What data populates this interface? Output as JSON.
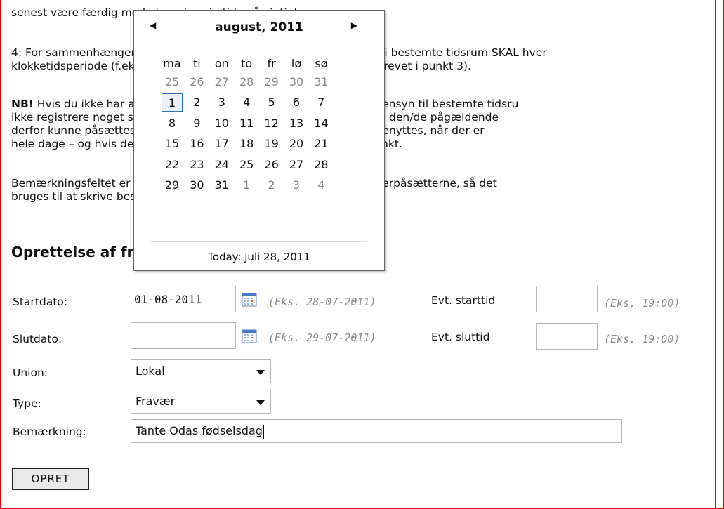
{
  "paragraphs": {
    "p0": "senest være færdig med at angive sin tid - så vigtigt.",
    "p1_line1": "4: For sammenhængende tidsrum hvor dommeren ikke kan dømme i bestemte tidsrum SKAL hver",
    "p1_line2": "klokketidsperiode (f.eks. 19:00-22:00) angives separatvis (som beskrevet i punkt 3).",
    "nb_label": "NB!",
    "p2_line1": " Hvis du ikke har angivet nogen begrænsede muligheder med hensyn til bestemte tidsru",
    "p2_line2": "ikke registrere noget som helst - da dommeren vil fremstå som ledig den/de pågældende",
    "p2_line3": "derfor kunne påsættes kampe. Felterne for tidsrum skal altså KUN benyttes, når der er",
    "p2_line4": "hele dage – og hvis det er tilfældet angives dets start- og sluttidspunkt.",
    "p3_line1": "Bemærkningsfeltet er til egne notater, og det kan ses ikke af dommerpåsætterne, så det",
    "p3_line2": "bruges til at skrive beskeder til dommerpåsætterne."
  },
  "heading": "Oprettelse af fravær",
  "form": {
    "start_label": "Startdato:",
    "start_value": "01-08-2011",
    "start_hint": "(Eks. 28-07-2011)",
    "start_time_label": "Evt. starttid",
    "start_time_value": "",
    "start_time_hint": "(Eks. 19:00)",
    "end_label": "Slutdato:",
    "end_value": "",
    "end_hint": "(Eks. 29-07-2011)",
    "end_time_label": "Evt. sluttid",
    "end_time_value": "",
    "end_time_hint": "(Eks. 19:00)",
    "union_label": "Union:",
    "union_value": "Lokal",
    "type_label": "Type:",
    "type_value": "Fravær",
    "remark_label": "Bemærkning:",
    "remark_value": "Tante Odas fødselsdag",
    "submit_label": "OPRET",
    "calendar_icon": "calendar-icon"
  },
  "calendar": {
    "title": "august, 2011",
    "prev": "◀",
    "next": "▶",
    "weekdays": [
      "ma",
      "ti",
      "on",
      "to",
      "fr",
      "lø",
      "sø"
    ],
    "weeks": [
      [
        "25",
        "26",
        "27",
        "28",
        "29",
        "30",
        "31"
      ],
      [
        "1",
        "2",
        "3",
        "4",
        "5",
        "6",
        "7"
      ],
      [
        "8",
        "9",
        "10",
        "11",
        "12",
        "13",
        "14"
      ],
      [
        "15",
        "16",
        "17",
        "18",
        "19",
        "20",
        "21"
      ],
      [
        "22",
        "23",
        "24",
        "25",
        "26",
        "27",
        "28"
      ],
      [
        "29",
        "30",
        "31",
        "1",
        "2",
        "3",
        "4"
      ]
    ],
    "other_month": [
      [
        true,
        true,
        true,
        true,
        true,
        true,
        true
      ],
      [
        false,
        false,
        false,
        false,
        false,
        false,
        false
      ],
      [
        false,
        false,
        false,
        false,
        false,
        false,
        false
      ],
      [
        false,
        false,
        false,
        false,
        false,
        false,
        false
      ],
      [
        false,
        false,
        false,
        false,
        false,
        false,
        false
      ],
      [
        false,
        false,
        false,
        true,
        true,
        true,
        true
      ]
    ],
    "selected_day": "1",
    "today": "Today: juli 28, 2011"
  },
  "colors": {
    "frame": "#cc1111",
    "selected": "#2e6fb8",
    "hint": "#8a8a8a"
  }
}
